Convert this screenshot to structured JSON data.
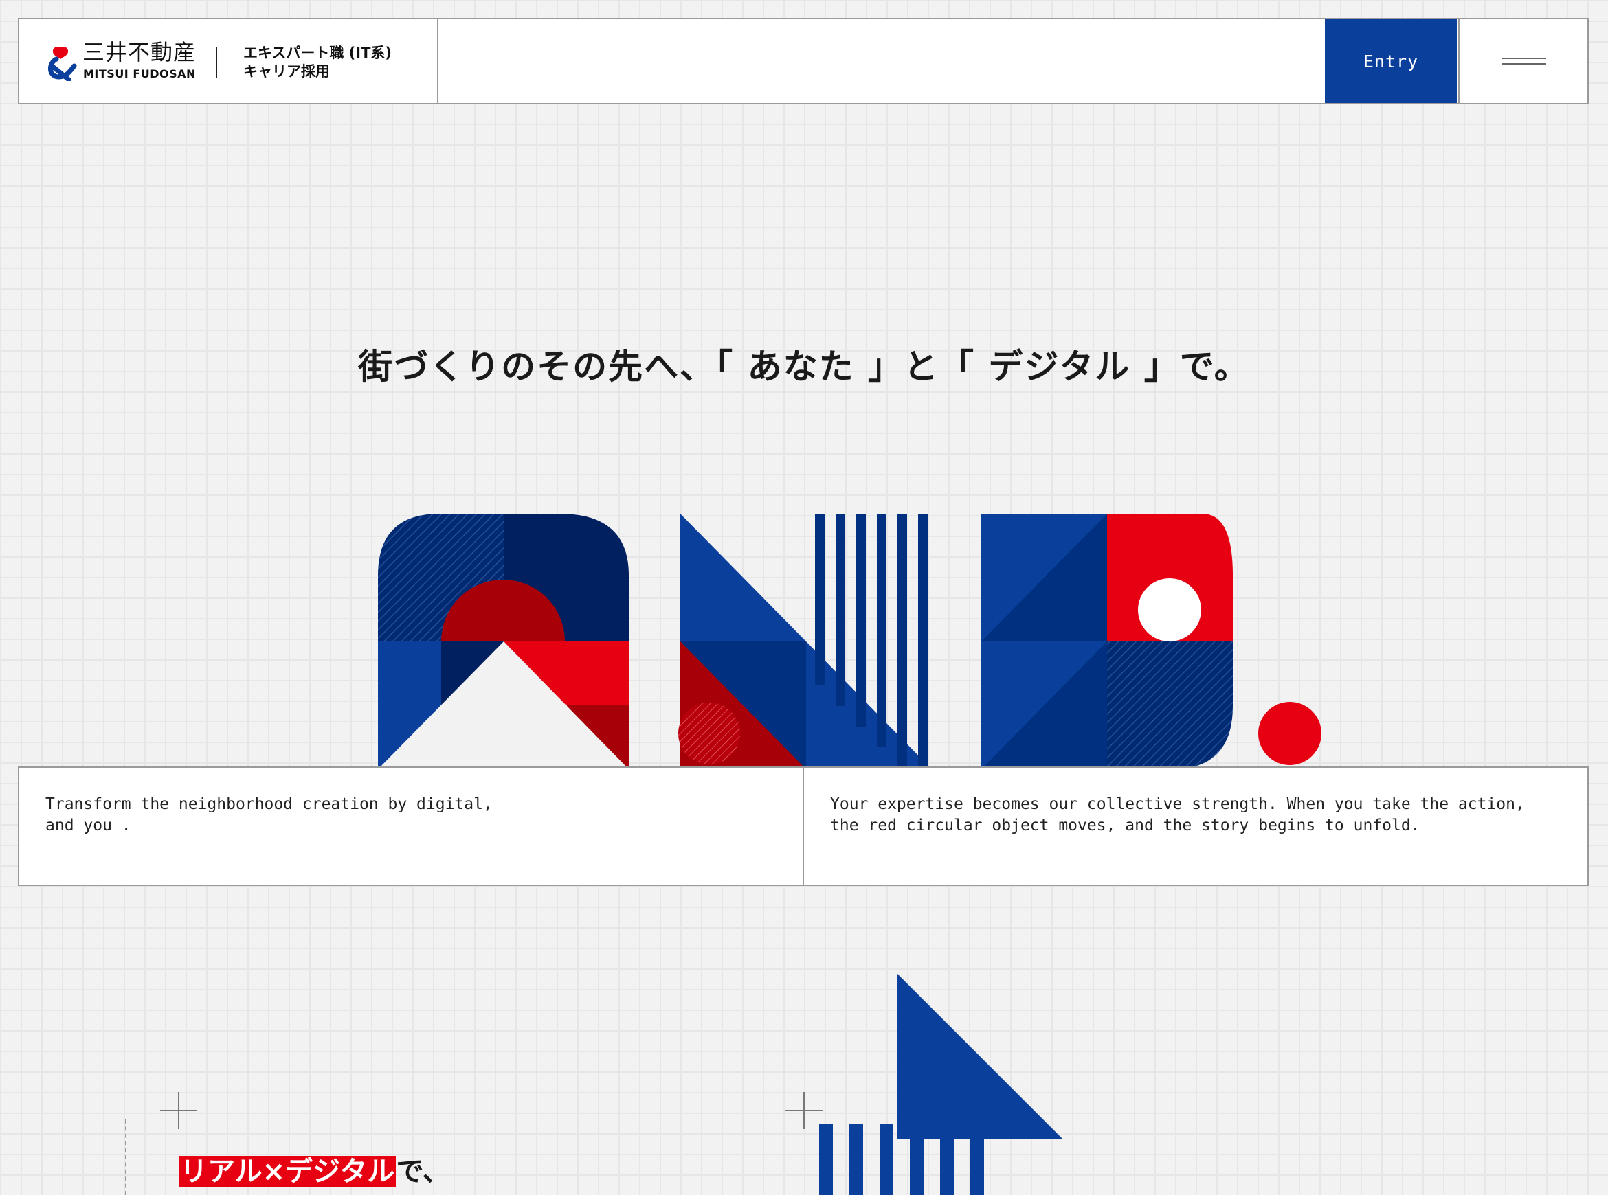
{
  "header": {
    "logo_ja": "三井不動産",
    "logo_en": "MITSUI FUDOSAN",
    "subtitle": "エキスパート職 (IT系)\nキャリア採用",
    "entry_label": "Entry"
  },
  "hero": {
    "headline": "街づくりのその先へ、「 あなた 」と「 デジタル 」で。",
    "art_text": "AND."
  },
  "caption": {
    "left": "Transform the neighborhood creation by digital,\nand you .",
    "right": "Your expertise becomes our collective strength. When you take the action, the red circular object moves, and the story begins to unfold."
  },
  "section": {
    "heading_highlight": "リアル×デジタル",
    "heading_rest": "で、"
  },
  "colors": {
    "brand_blue": "#0a3f9c",
    "navy": "#00205f",
    "red": "#e60012",
    "dark_red": "#a80008"
  }
}
